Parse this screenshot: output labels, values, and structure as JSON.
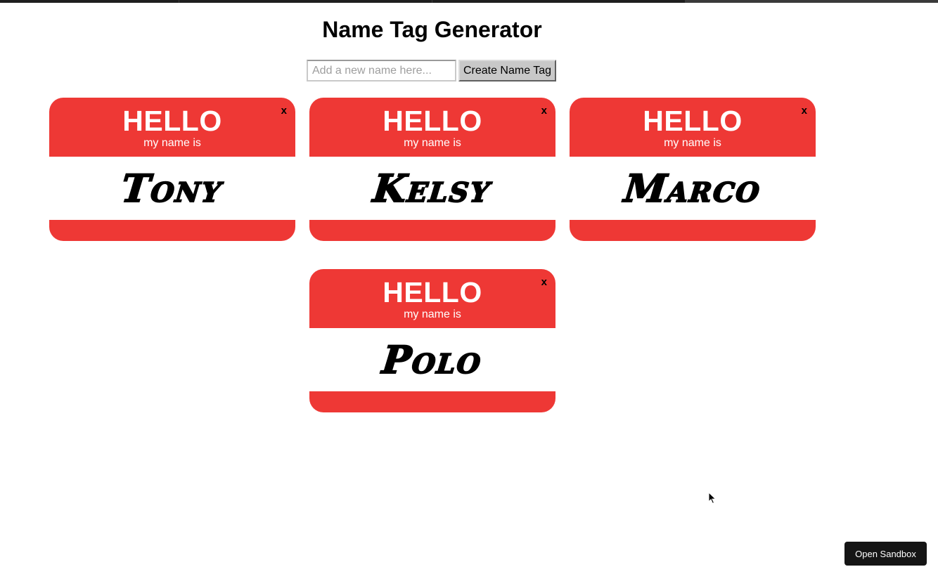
{
  "title": "Name Tag Generator",
  "form": {
    "input_value": "",
    "input_placeholder": "Add a new name here...",
    "submit_label": "Create Name Tag"
  },
  "tag_labels": {
    "hello": "HELLO",
    "subtitle": "my name is",
    "close": "x"
  },
  "tags": [
    {
      "name": "Tony"
    },
    {
      "name": "Kelsy"
    },
    {
      "name": "Marco"
    },
    {
      "name": "Polo"
    }
  ],
  "sandbox_button": "Open Sandbox",
  "colors": {
    "tag_red": "#ee3835",
    "sandbox_bg": "#151515"
  }
}
